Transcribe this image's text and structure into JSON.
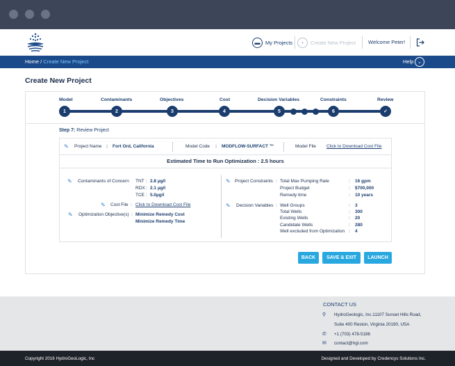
{
  "header": {
    "my_projects": "My Projects",
    "create_new_project": "Create New Project",
    "welcome": "Welcome Peter!"
  },
  "breadcrumb": {
    "home": "Home",
    "separator": " / ",
    "current": "Create New Project",
    "help": "Help"
  },
  "page_title": "Create New Project",
  "wizard": {
    "steps": [
      {
        "label": "Model",
        "number": "1"
      },
      {
        "label": "Contaminants",
        "number": "2"
      },
      {
        "label": "Objectives",
        "number": "3"
      },
      {
        "label": "Cost",
        "number": "4"
      },
      {
        "label": "Decision Variables",
        "number": "5"
      },
      {
        "label": "Constraints",
        "number": "6"
      },
      {
        "label": "Review",
        "number": "✓"
      }
    ],
    "current_step_prefix": "Step 7:",
    "current_step_title": "Review Project"
  },
  "review": {
    "project_name_label": "Project Name",
    "project_name_value": "Fort Ord, California",
    "model_code_label": "Model Code",
    "model_code_value": "MODFLOW-SURFACT ™",
    "model_file_label": "Model File",
    "model_file_link": "Click to Download Cost File",
    "estimate": "Estimated Time to Run Optimization : 2.5 hours",
    "contaminants_label": "Contaminants of Concern",
    "contaminants": [
      {
        "name": "TNT",
        "value": "2.8 µg/l"
      },
      {
        "name": "RDX",
        "value": "2.1 µg/l"
      },
      {
        "name": "TCE",
        "value": "5.0µg/l"
      }
    ],
    "cost_file_label": "Cost File",
    "cost_file_link": "Click to Download Cost File",
    "objectives_label": "Optimization Objective(s)",
    "objectives": [
      "Minimize Remedy Cost",
      "Minimize Remedy Time"
    ],
    "constraints_label": "Project Constraints",
    "constraints": [
      {
        "name": "Total Max Pumping Rate",
        "value": "16 gpm"
      },
      {
        "name": "Project Budget",
        "value": "$700,000"
      },
      {
        "name": "Remedy time",
        "value": "10 years"
      }
    ],
    "decision_label": "Decision Variables",
    "decision": [
      {
        "name": "Well Groups",
        "value": "3"
      },
      {
        "name": "Total Wells",
        "value": "300"
      },
      {
        "name": "Existing Wells",
        "value": "20"
      },
      {
        "name": "Candidate Wells",
        "value": "280"
      },
      {
        "name": "Well excluded from Optimization",
        "value": "4"
      }
    ]
  },
  "actions": {
    "back": "BACK",
    "save_exit": "SAVE & EXIT",
    "launch": "LAUNCH"
  },
  "footer": {
    "contact_title": "CONTACT US",
    "address_line1": "HydroGeologic, Inc.11107 Sunset Hills Road,",
    "address_line2": "Suite 400 Reston, Virginia 20190, USA",
    "phone": "+1 (703) 478-5186",
    "email": "contact@hgl.com",
    "copyright": "Copyright 2016 HydroGeoLogic, Inc",
    "credit": "Designed and Developed by Credencys Solutions Inc."
  },
  "colors": {
    "primary": "#1b3d6e",
    "bar": "#1b4a8a",
    "accent": "#29a8e0",
    "chrome": "#3d4658"
  }
}
